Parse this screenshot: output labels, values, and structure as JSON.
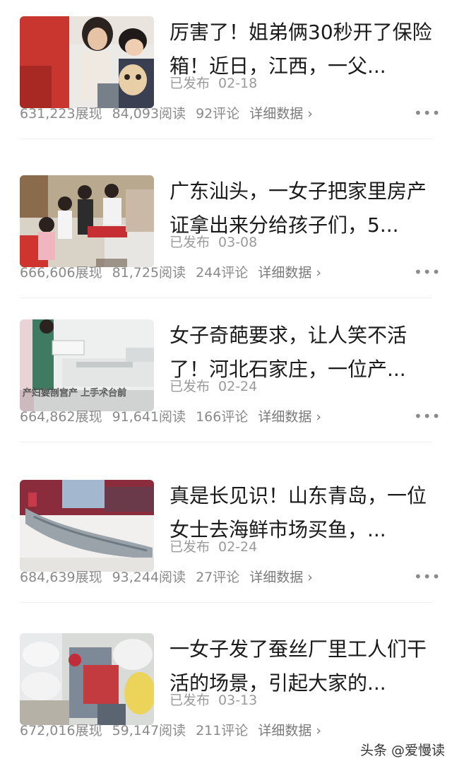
{
  "articles": [
    {
      "title": "厉害了！姐弟俩30秒开了保险箱！近日，江西，一父...",
      "status": "已发布",
      "date": "02-18",
      "views": "631,223展现",
      "reads": "84,093阅读",
      "comments": "92评论",
      "detail": "详细数据 ›"
    },
    {
      "title": "广东汕头，一女子把家里房产证拿出来分给孩子们，5...",
      "status": "已发布",
      "date": "03-08",
      "views": "666,606展现",
      "reads": "81,725阅读",
      "comments": "244评论",
      "detail": "详细数据 ›"
    },
    {
      "title": "女子奇葩要求，让人笑不活了！河北石家庄，一位产...",
      "status": "已发布",
      "date": "02-24",
      "views": "664,862展现",
      "reads": "91,641阅读",
      "comments": "166评论",
      "detail": "详细数据 ›",
      "thumb_caption": "产妇要剖宫产 上手术台前"
    },
    {
      "title": "真是长见识！山东青岛，一位女士去海鲜市场买鱼，...",
      "status": "已发布",
      "date": "02-24",
      "views": "684,639展现",
      "reads": "93,244阅读",
      "comments": "27评论",
      "detail": "详细数据 ›"
    },
    {
      "title": "一女子发了蚕丝厂里工人们干活的场景，引起大家的...",
      "status": "已发布",
      "date": "03-13",
      "views": "672,016展现",
      "reads": "59,147阅读",
      "comments": "211评论",
      "detail": "详细数据 ›"
    }
  ],
  "more_icon": "more-dots-icon",
  "watermark": "头条 @爱慢读",
  "colors": {
    "title": "#1a1a1a",
    "meta": "#8a8a8a",
    "divider": "#efefef",
    "background": "#ffffff"
  }
}
